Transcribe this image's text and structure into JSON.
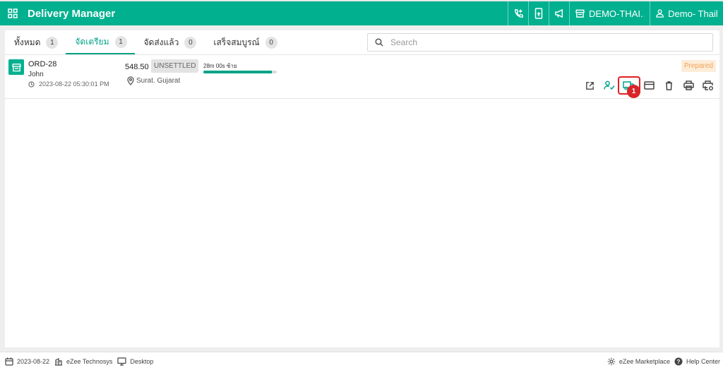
{
  "header": {
    "title": "Delivery Manager",
    "store_label": "DEMO-THAI...",
    "user_label": "Demo- Thail..."
  },
  "tabs": [
    {
      "label": "ทั้งหมด",
      "count": "1"
    },
    {
      "label": "จัดเตรียม",
      "count": "1"
    },
    {
      "label": "จัดส่งแล้ว",
      "count": "0"
    },
    {
      "label": "เสร็จสมบูรณ์",
      "count": "0"
    }
  ],
  "search": {
    "placeholder": "Search",
    "value": ""
  },
  "order": {
    "id": "ORD-28",
    "customer": "John",
    "datetime": "2023-08-22 05:30:01 PM",
    "amount": "548.50",
    "payment_status": "UNSETTLED",
    "timer": "28m 00s ซ้าย",
    "progress": 0.93,
    "location": "Surat. Gujarat",
    "status": "Prepared"
  },
  "annotation": {
    "marker": "1"
  },
  "footer": {
    "date": "2023-08-22",
    "company": "eZee Technosys",
    "device": "Desktop",
    "marketplace": "eZee Marketplace",
    "help": "Help Center"
  },
  "colors": {
    "accent": "#00b08f",
    "status_bg": "#fdecd8",
    "status_text": "#f0a35a",
    "highlight": "#e02020"
  }
}
